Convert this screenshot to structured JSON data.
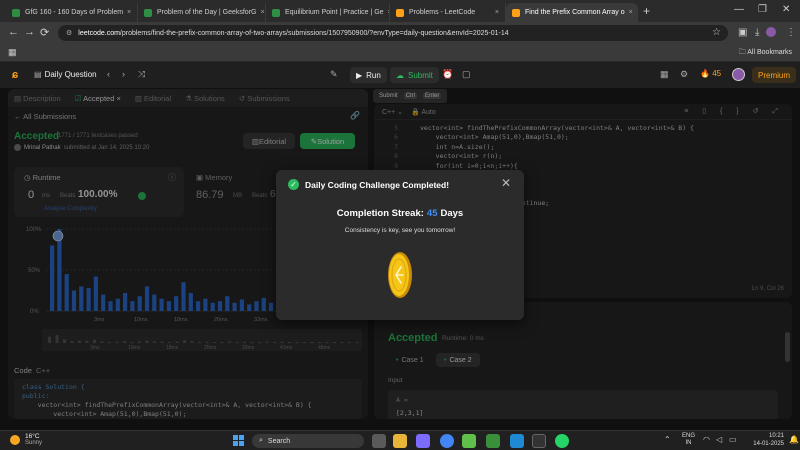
{
  "browser": {
    "tabs": [
      {
        "title": "GfG 160 - 160 Days of Problem",
        "color": "#2f8d46"
      },
      {
        "title": "Problem of the Day | GeeksforG",
        "color": "#2f8d46"
      },
      {
        "title": "Equilibrium Point | Practice | Ge",
        "color": "#2f8d46"
      },
      {
        "title": "Problems - LeetCode",
        "color": "#ffa116"
      },
      {
        "title": "Find the Prefix Common Array o",
        "color": "#ffa116"
      }
    ],
    "url_host": "leetcode.com",
    "url_path": "/problems/find-the-prefix-common-array-of-two-arrays/submissions/1507950900/?envType=daily-question&envId=2025-01-14",
    "all_bookmarks": "All Bookmarks"
  },
  "header": {
    "title": "Daily Question",
    "run_label": "Run",
    "submit_label": "Submit",
    "streak_count": "45",
    "premium_label": "Premium"
  },
  "tooltip": {
    "label": "Submit",
    "key1": "Ctrl",
    "key2": "Enter"
  },
  "left": {
    "tabs": [
      "Description",
      "Accepted",
      "Editorial",
      "Solutions",
      "Submissions"
    ],
    "all_submissions": "All Submissions",
    "status": "Accepted",
    "testcases": "1771 / 1771 testcases passed",
    "user": "Mrinal Pathak",
    "submitted": "submitted at Jan 14, 2025 10:20",
    "editorial_btn": "Editorial",
    "solution_btn": "Solution",
    "runtime": {
      "label": "Runtime",
      "value": "0",
      "unit": "ms",
      "beats": "Beats",
      "percent": "100.00%",
      "analyze": "Analyze Complexity"
    },
    "memory": {
      "label": "Memory",
      "value": "86.79",
      "unit": "MB",
      "beats": "Beats",
      "percent": "60.0"
    },
    "code_label": "Code",
    "code_lang": "C++",
    "code_lines": [
      "class Solution {",
      "public:",
      "    vector<int> findThePrefixCommonArray(vector<int>& A, vector<int>& B) {",
      "        vector<int> Amap(51,0),Bmap(51,0);"
    ]
  },
  "histogram": {
    "y_ticks": [
      "100%",
      "50%",
      "0%"
    ],
    "x_ticks": [
      "3ms",
      "10ms",
      "18ms",
      "26ms",
      "33ms"
    ],
    "mini_ticks": [
      "3ms",
      "10ms",
      "18ms",
      "25ms",
      "33ms",
      "41ms",
      "48ms"
    ],
    "bars": [
      0.8,
      1.0,
      0.45,
      0.25,
      0.3,
      0.28,
      0.42,
      0.2,
      0.12,
      0.15,
      0.22,
      0.12,
      0.18,
      0.3,
      0.2,
      0.15,
      0.12,
      0.18,
      0.35,
      0.22,
      0.12,
      0.15,
      0.1,
      0.12,
      0.18,
      0.1,
      0.14,
      0.08,
      0.12,
      0.16,
      0.1,
      0.14,
      0.08,
      0.1,
      0.06,
      0.08,
      0.1,
      0.06,
      0.08,
      0.05,
      0.07,
      0.06
    ],
    "bar_color": "#2d6bd0"
  },
  "editor": {
    "lang": "C++",
    "mode": "Auto",
    "lines": [
      {
        "n": "5",
        "t": "vector<int> findThePrefixCommonArray(vector<int>& A, vector<int>& B) {"
      },
      {
        "n": "6",
        "t": "    vector<int> Amap(51,0),Bmap(51,0);"
      },
      {
        "n": "7",
        "t": "    int n=A.size();"
      },
      {
        "n": "8",
        "t": "    vector<int> r(n);"
      },
      {
        "n": "9",
        "t": "    for(int i=0;i<n;i++){"
      },
      {
        "n": "10",
        "t": ""
      },
      {
        "n": "11",
        "t": ""
      },
      {
        "n": "12",
        "t": "                    {"
      },
      {
        "n": "13",
        "t": "                        continue;"
      },
      {
        "n": "14",
        "t": "                    curr++;"
      },
      {
        "n": "15",
        "t": ""
      }
    ],
    "position": "Ln 9, Col 26"
  },
  "result": {
    "status": "Accepted",
    "runtime": "Runtime: 0 ms",
    "case1": "Case 1",
    "case2": "Case 2",
    "input_label": "Input",
    "var": "A =",
    "value": "[2,3,1]"
  },
  "modal": {
    "title": "Daily Coding Challenge Completed!",
    "streak_label": "Completion Streak:",
    "streak_value": "45",
    "streak_unit": "Days",
    "subtitle": "Consistency is key, see you tomorrow!"
  },
  "taskbar": {
    "temp": "16°C",
    "condition": "Sunny",
    "search": "Search",
    "lang1": "ENG",
    "lang2": "IN",
    "time": "10:21",
    "date": "14-01-2025"
  },
  "colors": {
    "green": "#2cbb5d",
    "orange": "#ffa116",
    "blue": "#3e8ef7"
  }
}
